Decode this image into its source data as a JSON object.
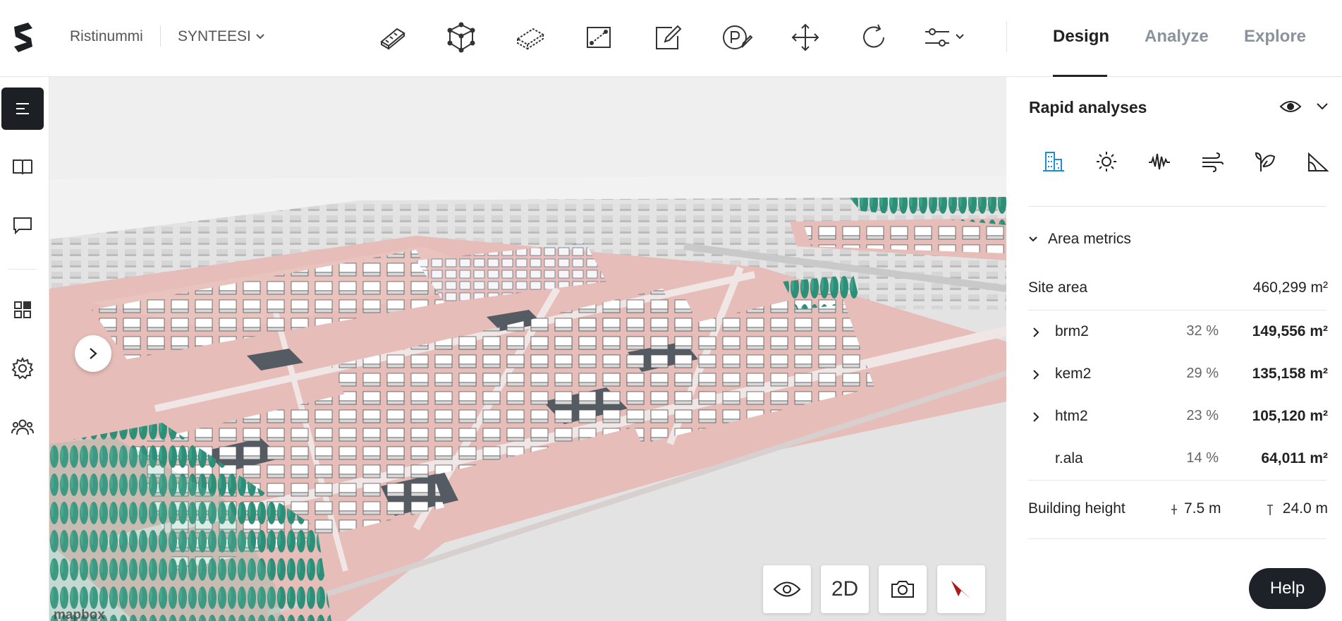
{
  "header": {
    "project_name": "Ristinummi",
    "scenario_name": "SYNTEESI",
    "tools": [
      {
        "name": "street-tool-icon"
      },
      {
        "name": "building-tool-icon"
      },
      {
        "name": "block-tool-icon"
      },
      {
        "name": "area-tool-icon"
      },
      {
        "name": "edit-area-tool-icon"
      },
      {
        "name": "parking-tool-icon"
      },
      {
        "name": "move-tool-icon"
      },
      {
        "name": "rotate-tool-icon"
      },
      {
        "name": "settings-tool-icon"
      }
    ],
    "modes": {
      "design": "Design",
      "analyze": "Analyze",
      "explore": "Explore"
    },
    "active_mode": "Design"
  },
  "left_rail": {
    "items": [
      {
        "name": "menu-icon",
        "active": true
      },
      {
        "name": "book-icon"
      },
      {
        "name": "comment-icon"
      },
      {
        "name": "dashboard-icon"
      },
      {
        "name": "gear-icon"
      },
      {
        "name": "users-icon"
      }
    ]
  },
  "map": {
    "view_2d_label": "2D",
    "attribution": "mapbox"
  },
  "panel": {
    "title": "Rapid analyses",
    "analyses": [
      "buildings-icon",
      "sun-icon",
      "noise-icon",
      "wind-icon",
      "nature-icon",
      "slope-icon"
    ],
    "section_title": "Area metrics",
    "site_area": {
      "label": "Site area",
      "value": "460,299 m²"
    },
    "rows": [
      {
        "label": "brm2",
        "pct": "32 %",
        "value": "149,556 m²",
        "expandable": true
      },
      {
        "label": "kem2",
        "pct": "29 %",
        "value": "135,158 m²",
        "expandable": true
      },
      {
        "label": "htm2",
        "pct": "23 %",
        "value": "105,120 m²",
        "expandable": true
      },
      {
        "label": "r.ala",
        "pct": "14 %",
        "value": "64,011 m²",
        "expandable": false
      }
    ],
    "building_height": {
      "label": "Building height",
      "min": "7.5 m",
      "max": "24.0 m"
    }
  },
  "help_label": "Help",
  "colors": {
    "accent_blue": "#1a8fd8",
    "tree_green": "#2e8f78",
    "plot_pink": "#e6b9b4",
    "dark": "#1c1f24"
  }
}
